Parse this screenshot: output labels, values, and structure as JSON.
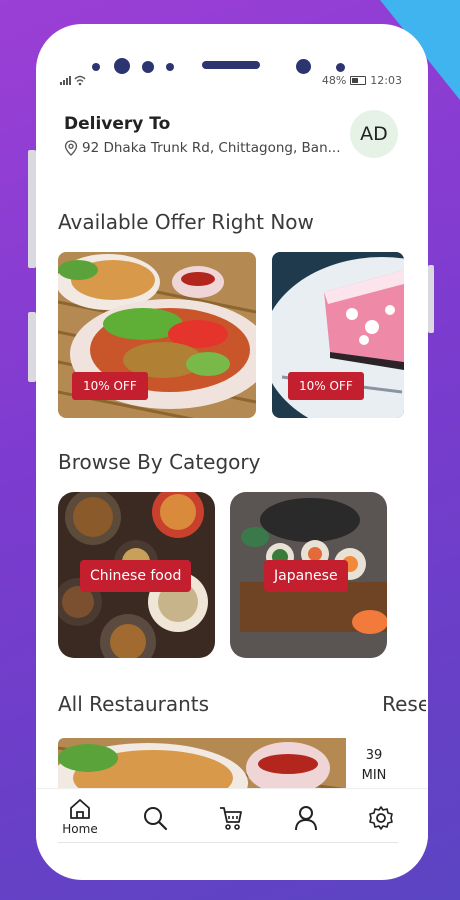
{
  "status_bar": {
    "signal": "▐▌ ≋",
    "battery_pct": "48%",
    "time": "12:03"
  },
  "delivery": {
    "title": "Delivery To",
    "address": "92 Dhaka Trunk Rd, Chittagong, Ban...",
    "avatar": "AD"
  },
  "offers": {
    "title": "Available Offer Right Now",
    "items": [
      {
        "badge": "10% OFF"
      },
      {
        "badge": "10% OFF"
      }
    ]
  },
  "categories": {
    "title": "Browse By Category",
    "items": [
      {
        "label": "Chinese food"
      },
      {
        "label": "Japanese"
      }
    ]
  },
  "restaurants": {
    "title": "All Restaurants",
    "reset_label": "Reset",
    "eta_value": "39",
    "eta_unit": "MIN"
  },
  "nav": {
    "items": [
      {
        "label": "Home",
        "icon": "home-icon"
      },
      {
        "icon": "search-icon"
      },
      {
        "icon": "cart-icon"
      },
      {
        "icon": "profile-icon"
      },
      {
        "icon": "settings-icon"
      }
    ]
  },
  "colors": {
    "accent": "#c31f2e",
    "background_start": "#9b3fd6",
    "background_end": "#5b45c2",
    "corner": "#3fb4ee"
  }
}
